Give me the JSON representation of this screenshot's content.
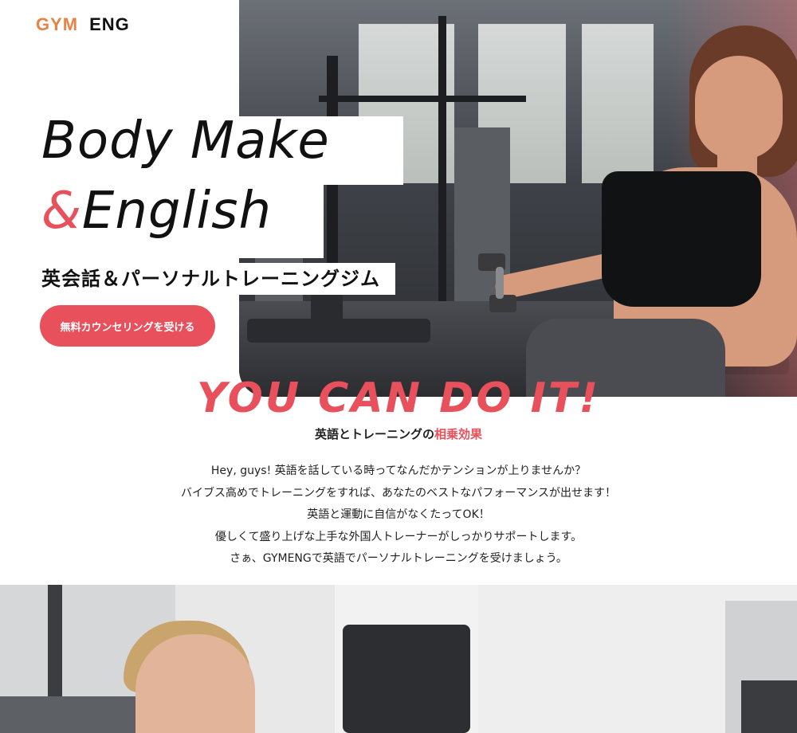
{
  "logo": {
    "gym": "GYM",
    "eng": "ENG"
  },
  "hero": {
    "line1": "Body Make",
    "amp": "&",
    "line2": "English",
    "subtitle": "英会話＆パーソナルトレーニングジム",
    "cta_label": "無料カウンセリングを受ける"
  },
  "slogan": "YOU CAN DO IT!",
  "tagline": {
    "lead": "英語とトレーニングの",
    "accent": "相乗効果"
  },
  "body_lines": [
    "Hey, guys! 英語を話している時ってなんだかテンションが上りませんか？",
    "バイブス高めでトレーニングをすれば、あなたのベストなパフォーマンスが出せます！",
    "英語と運動に自信がなくたってOK！",
    "優しくて盛り上げな上手な外国人トレーナーがしっかりサポートします。",
    "さぁ、GYMENGで英語でパーソナルトレーニングを受けましょう。"
  ],
  "colors": {
    "accent": "#e8505b",
    "logo_orange": "#e88245"
  }
}
